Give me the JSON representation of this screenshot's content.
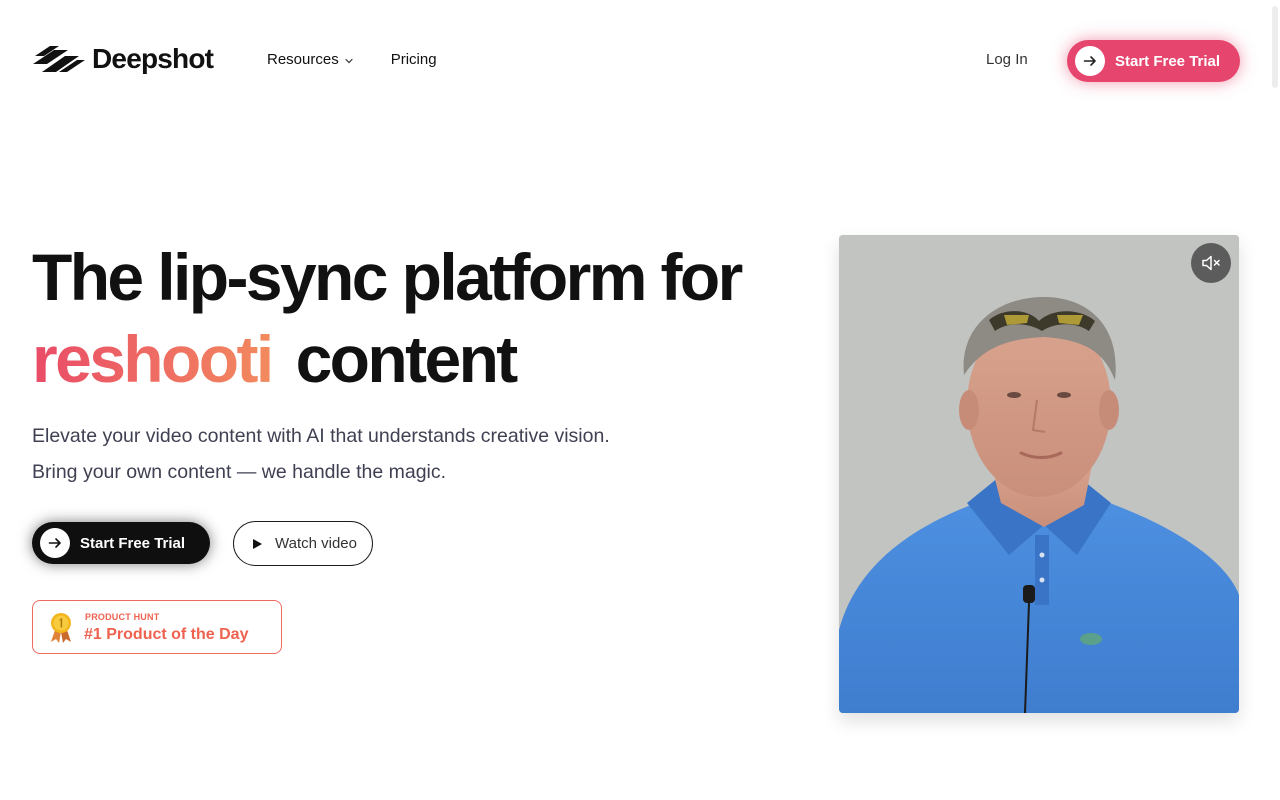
{
  "brand": {
    "name": "Deepshot",
    "logo_icon": "wave-stripes-logo-icon"
  },
  "nav": {
    "items": [
      {
        "label": "Resources",
        "icon": "chevron-down-icon"
      },
      {
        "label": "Pricing"
      }
    ],
    "login_label": "Log In",
    "cta_label": "Start Free Trial"
  },
  "hero": {
    "headline_line1": "The lip-sync platform for",
    "headline_accent": "reshooti",
    "headline_line2_rest": "content",
    "subtext_line1": "Elevate your video content with AI that understands creative vision.",
    "subtext_line2": "Bring your own content — we handle the magic.",
    "primary_cta_label": "Start Free Trial",
    "secondary_cta_label": "Watch video",
    "badge_kicker": "PRODUCT HUNT",
    "badge_title": "#1 Product of the Day"
  },
  "video": {
    "muted": true,
    "mute_icon": "speaker-muted-icon"
  },
  "colors": {
    "accent": "#e6466e",
    "accent_gradient_start": "#e94b67",
    "accent_gradient_end": "#f28b5e",
    "badge": "#ef6250",
    "text_primary": "#111111",
    "text_secondary": "#3f4152"
  }
}
